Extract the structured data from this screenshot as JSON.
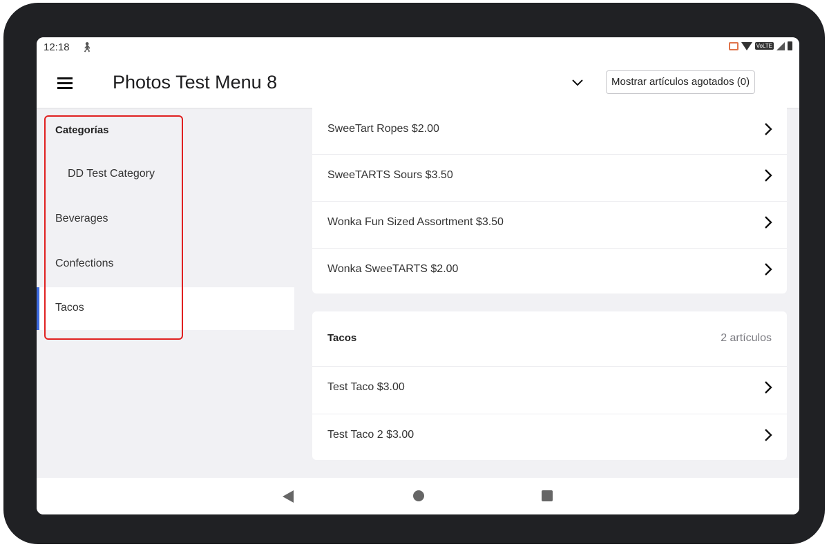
{
  "status_bar": {
    "time": "12:18",
    "icons": [
      "walk-icon",
      "cast-icon",
      "wifi-icon",
      "volte-icon",
      "signal-icon",
      "battery-icon"
    ],
    "volte_label": "VoLTE"
  },
  "app_bar": {
    "title": "Photos Test Menu 8",
    "sold_out_button": "Mostrar artículos agotados (0)"
  },
  "sidebar": {
    "heading": "Categorías",
    "items": [
      {
        "label": "DD Test Category",
        "active": false
      },
      {
        "label": "Beverages",
        "active": false
      },
      {
        "label": "Confections",
        "active": false
      },
      {
        "label": "Tacos",
        "active": true
      }
    ],
    "active_indicator_color": "#3d6be0",
    "highlight_color": "#e02020"
  },
  "content": {
    "confections_items": [
      "SweeTart Ropes $2.00",
      "SweeTARTS Sours $3.50",
      "Wonka Fun Sized Assortment $3.50",
      "Wonka SweeTARTS $2.00"
    ],
    "tacos_section": {
      "title": "Tacos",
      "count": "2 artículos",
      "items": [
        "Test Taco $3.00",
        "Test Taco 2 $3.00"
      ]
    }
  },
  "nav_bar": {
    "buttons": [
      "back-icon",
      "home-icon",
      "recents-icon"
    ]
  }
}
